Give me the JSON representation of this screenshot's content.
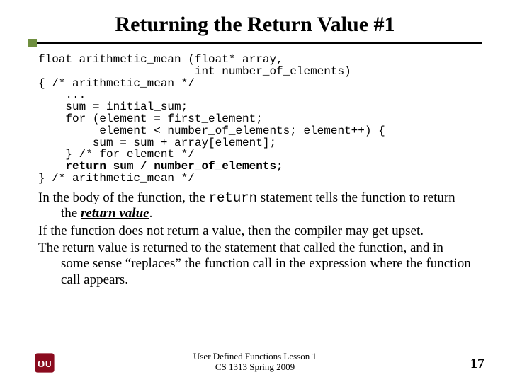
{
  "title": "Returning the Return Value #1",
  "code": {
    "l1": "float arithmetic_mean (float* array,",
    "l2": "                       int number_of_elements)",
    "l3": "{ /* arithmetic_mean */",
    "l4": "    ...",
    "l5": "    sum = initial_sum;",
    "l6": "    for (element = first_element;",
    "l7": "         element < number_of_elements; element++) {",
    "l8": "        sum = sum + array[element];",
    "l9": "    } /* for element */",
    "l10": "    return sum / number_of_elements;",
    "l11": "} /* arithmetic_mean */"
  },
  "body": {
    "p1a": "In the body of the function, the ",
    "p1b": "return",
    "p1c": " statement tells the function to return the ",
    "p1d": "return value",
    "p1e": ".",
    "p2": "If the function does not return a value, then the compiler may get upset.",
    "p3": "The return value is returned to the statement that called the function, and in some sense “replaces” the function call in the expression where the function call appears."
  },
  "footer": {
    "line1": "User Defined Functions Lesson 1",
    "line2": "CS 1313 Spring 2009"
  },
  "page_number": "17"
}
